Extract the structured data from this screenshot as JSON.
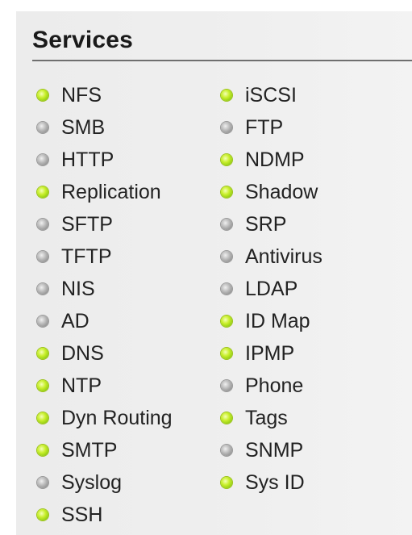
{
  "panel": {
    "title": "Services"
  },
  "colors": {
    "on": "#a6dc1b",
    "off": "#999999",
    "text": "#222222"
  },
  "services": {
    "left": [
      {
        "label": "NFS",
        "status": "on"
      },
      {
        "label": "SMB",
        "status": "off"
      },
      {
        "label": "HTTP",
        "status": "off"
      },
      {
        "label": "Replication",
        "status": "on"
      },
      {
        "label": "SFTP",
        "status": "off"
      },
      {
        "label": "TFTP",
        "status": "off"
      },
      {
        "label": "NIS",
        "status": "off"
      },
      {
        "label": "AD",
        "status": "off"
      },
      {
        "label": "DNS",
        "status": "on"
      },
      {
        "label": "NTP",
        "status": "on"
      },
      {
        "label": "Dyn Routing",
        "status": "on"
      },
      {
        "label": "SMTP",
        "status": "on"
      },
      {
        "label": "Syslog",
        "status": "off"
      },
      {
        "label": "SSH",
        "status": "on"
      }
    ],
    "right": [
      {
        "label": "iSCSI",
        "status": "on"
      },
      {
        "label": "FTP",
        "status": "off"
      },
      {
        "label": "NDMP",
        "status": "on"
      },
      {
        "label": "Shadow",
        "status": "on"
      },
      {
        "label": "SRP",
        "status": "off"
      },
      {
        "label": "Antivirus",
        "status": "off"
      },
      {
        "label": "LDAP",
        "status": "off"
      },
      {
        "label": "ID Map",
        "status": "on"
      },
      {
        "label": "IPMP",
        "status": "on"
      },
      {
        "label": "Phone",
        "status": "off"
      },
      {
        "label": "Tags",
        "status": "on"
      },
      {
        "label": "SNMP",
        "status": "off"
      },
      {
        "label": "Sys ID",
        "status": "on"
      }
    ]
  }
}
